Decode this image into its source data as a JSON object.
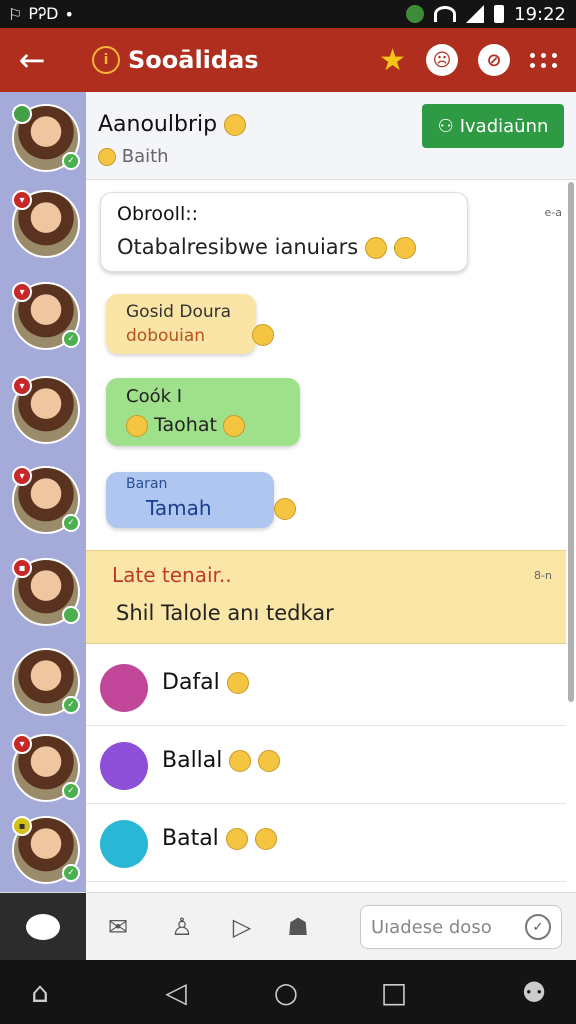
{
  "status_bar": {
    "time": "19:22",
    "left_text": "PᎮD"
  },
  "app_bar": {
    "title": "Sooālidas",
    "logo_glyph": "i"
  },
  "chat_header": {
    "name": "Aanoulbrip",
    "subtitle": "Baith",
    "button_label": "Ivadiaūnn"
  },
  "messages": [
    {
      "sender": "Obrooll::",
      "text": "Otabalresibwe ianuiars",
      "time": "e-a"
    },
    {
      "sender": "Gosid Doura",
      "text": "dobouian"
    },
    {
      "sender": "Coók I",
      "text": "Taohat"
    },
    {
      "sender": "Baran",
      "text": "Tamah"
    }
  ],
  "highlight": {
    "title": "Late tenair..",
    "body": "Shil Talole anı tedkar",
    "time": "8-n"
  },
  "list_items": [
    {
      "label": "Dafal",
      "color": "#c2479a"
    },
    {
      "label": "Ballal",
      "color": "#8d4ed8"
    },
    {
      "label": "Batal",
      "color": "#2ab7d6"
    }
  ],
  "input": {
    "placeholder": "Uıadese doso"
  },
  "colors": {
    "appbar": "#b02e1e",
    "sidebar": "#a4abd8",
    "accent_green": "#2e9a44"
  }
}
